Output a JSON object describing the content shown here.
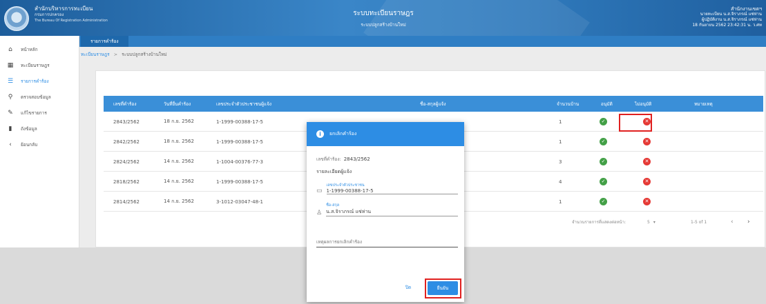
{
  "header": {
    "org_line1": "สำนักบริหารการทะเบียน",
    "org_line2": "กรมการปกครอง",
    "org_line3": "The Bureau Of Registration Administration",
    "title": "ระบบทะเบียนราษฎร",
    "subtitle": "ระบบปลูกสร้างบ้านใหม่",
    "user_line1": "สำนักงานเขตฯ",
    "user_line2": "นายทะเบียน น.ส.จิราภรณ์ แซ่ห่าน",
    "user_line3": "ผู้ปฏิบัติงาน น.ส.จิราภรณ์ แซ่ห่าน",
    "user_line4": "18 กันยายน 2562 23:42:31 น. ว.ศท"
  },
  "sidebar": {
    "items": [
      {
        "label": "หน้าหลัก",
        "icon": "home-icon"
      },
      {
        "label": "ทะเบียนราษฎร",
        "icon": "grid-icon"
      },
      {
        "label": "รายการคำร้อง",
        "icon": "list-icon"
      },
      {
        "label": "ตรวจสอบข้อมูล",
        "icon": "search-icon"
      },
      {
        "label": "แก้ไขรายการ",
        "icon": "pencil-icon"
      },
      {
        "label": "ถังข้อมูล",
        "icon": "trash-icon"
      },
      {
        "label": "ย้อนกลับ",
        "icon": "chevron-left-icon"
      }
    ]
  },
  "topbar": {
    "tab_label": "รายการคำร้อง"
  },
  "breadcrumb": {
    "root": "ทะเบียนราษฎร",
    "separator": ">",
    "current": "ระบบปลูกสร้างบ้านใหม่"
  },
  "table": {
    "columns": [
      "เลขที่คำร้อง",
      "วันที่ยื่นคำร้อง",
      "เลขประจำตัวประชาชนผู้แจ้ง",
      "ชื่อ-สกุลผู้แจ้ง",
      "จำนวนบ้าน",
      "อนุมัติ",
      "ไม่อนุมัติ",
      "หมายเหตุ"
    ],
    "rows": [
      {
        "request_no": "2843/2562",
        "date": "18 ก.ย. 2562",
        "id": "1-1999-00388-17-5",
        "houses": "1"
      },
      {
        "request_no": "2842/2562",
        "date": "18 ก.ย. 2562",
        "id": "1-1999-00388-17-5",
        "houses": "1"
      },
      {
        "request_no": "2824/2562",
        "date": "14 ก.ย. 2562",
        "id": "1-1004-00376-77-3",
        "houses": "3"
      },
      {
        "request_no": "2818/2562",
        "date": "14 ก.ย. 2562",
        "id": "1-1999-00388-17-5",
        "houses": "4"
      },
      {
        "request_no": "2814/2562",
        "date": "14 ก.ย. 2562",
        "id": "3-1012-03047-48-1",
        "houses": "1"
      }
    ],
    "pager": {
      "rows_label": "จำนวนรายการที่แสดงต่อหน้า:",
      "rows_value": "5",
      "range": "1-5 of 1"
    }
  },
  "dialog": {
    "title": "ยกเลิกคำร้อง",
    "request_label": "เลขที่คำร้อง:",
    "request_value": "2843/2562",
    "section": "รายละเอียดผู้แจ้ง",
    "id_label": "เลขประจำตัวประชาชน",
    "id_value": "1-1999-00388-17-5",
    "name_label": "ชื่อ-สกุล",
    "name_value": "น.ส.จิราภรณ์ แซ่ห่าน",
    "reason_placeholder": "เหตุผลการยกเลิกคำร้อง",
    "cancel_label": "ปิด",
    "confirm_label": "ยืนยัน"
  },
  "colors": {
    "primary": "#2d8de4",
    "header": "#2f7ec4",
    "approve": "#43a047",
    "reject": "#e53935",
    "highlight": "#e0201f"
  }
}
